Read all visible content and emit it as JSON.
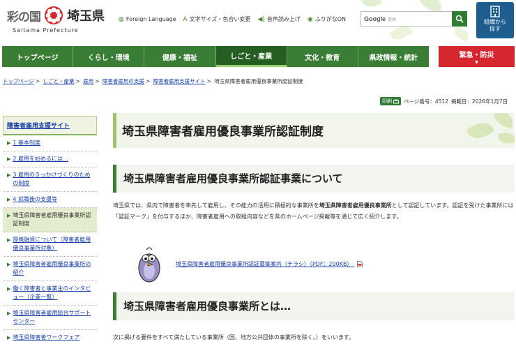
{
  "header": {
    "logo_motto": "彩の国",
    "logo_pref": "埼玉県",
    "logo_en": "Saitama Prefecture",
    "util": [
      {
        "label": "Foreign Language",
        "icon": "globe-icon"
      },
      {
        "label": "文字サイズ・色合い変更",
        "icon": "text-size-icon"
      },
      {
        "label": "音声読み上げ",
        "icon": "speaker-icon"
      },
      {
        "label": "ふりがなON",
        "icon": "furigana-icon"
      }
    ],
    "search": {
      "brand": "Google",
      "suffix": "提供"
    },
    "org_button": {
      "line1": "組織から",
      "line2": "探す"
    }
  },
  "nav": {
    "items": [
      {
        "label": "トップページ",
        "active": false
      },
      {
        "label": "くらし・環境",
        "active": false
      },
      {
        "label": "健康・福祉",
        "active": false
      },
      {
        "label": "しごと・産業",
        "active": true
      },
      {
        "label": "文化・教育",
        "active": false
      },
      {
        "label": "県政情報・統計",
        "active": false
      }
    ],
    "emergency": "緊急・防災"
  },
  "breadcrumb": {
    "links": [
      "トップページ",
      "しごと・産業",
      "雇用",
      "障害者雇用の支援",
      "障害者雇用支援サイト"
    ],
    "current": "埼玉県障害者雇用優良事業所認証制度"
  },
  "meta": {
    "print": "印刷",
    "page_no": "ページ番号：4512",
    "date": "掲載日：2026年1月7日"
  },
  "sidebar": {
    "title": "障害者雇用支援サイト",
    "items": [
      {
        "label": "1 基本制度",
        "active": false
      },
      {
        "label": "2 雇用を始めるには…",
        "active": false
      },
      {
        "label": "3 雇用のきっかけづくりのための制度",
        "active": false
      },
      {
        "label": "4 就職後の支援等",
        "active": false
      },
      {
        "label": "埼玉県障害者雇用優良事業所認証制度",
        "active": true
      },
      {
        "label": "提携融資について（障害者雇用優良事業所対象）",
        "active": false
      },
      {
        "label": "埼玉県障害者雇用優良事業所の紹介",
        "active": false
      },
      {
        "label": "働く障害者と事業主のインタビュー（企業一覧）",
        "active": false
      },
      {
        "label": "埼玉県障害者雇用総合サポートセンター",
        "active": false
      },
      {
        "label": "埼玉県障害者ワークフェア",
        "active": false
      }
    ]
  },
  "main": {
    "title": "埼玉県障害者雇用優良事業所認証制度",
    "section1": {
      "heading": "埼玉県障害者雇用優良事業所認証事業について",
      "para_pre": "埼玉県では、県内で障害者を率先して雇用し、その能力の活用に積極的な事業所を",
      "para_bold": "埼玉県障害者雇用優良事業所",
      "para_post": "として認証しています。認証を受けた事業所には「認証マーク」を付与するほか、障害者雇用への取組内容などを県のホームページ掲載等を通じて広く紹介します。",
      "link": "埼玉県障害者雇用優良事業所認証募集案内（チラシ）（PDF：290KB）"
    },
    "section2": {
      "heading": "埼玉県障害者雇用優良事業所とは…",
      "para": "次に掲げる要件をすべて満たしている事業所（国、地方公共団体の事業所を除く。）をいいます。"
    }
  },
  "colors": {
    "nav_green": "#3a7d34",
    "nav_active": "#255e21",
    "emergency_red": "#d6262e",
    "link_blue": "#1a3fa8",
    "org_blue": "#1d5e8f"
  }
}
